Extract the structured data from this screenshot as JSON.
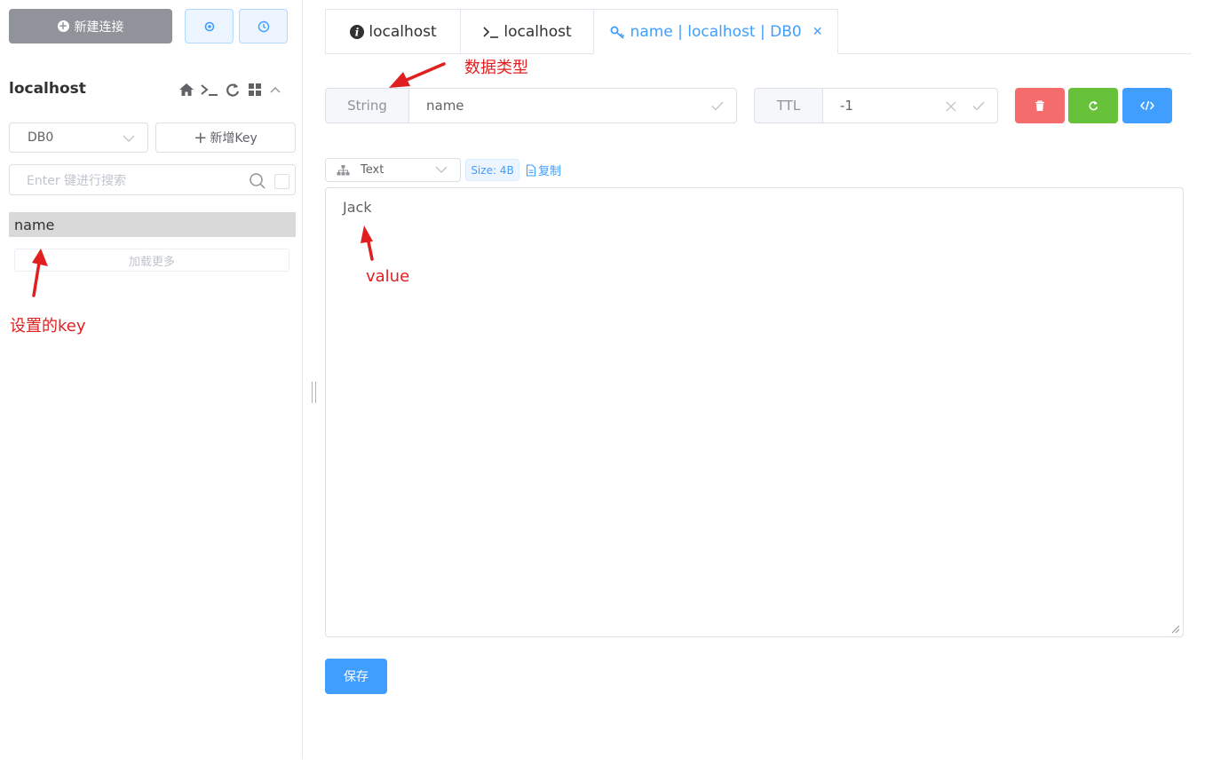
{
  "sidebar": {
    "new_connection_label": "新建连接",
    "connection_name": "localhost",
    "db_select_value": "DB0",
    "add_key_label": "新增Key",
    "search_placeholder": "Enter 键进行搜索",
    "keys": [
      "name"
    ],
    "load_more_label": "加载更多"
  },
  "tabs": [
    {
      "label": "localhost",
      "icon": "info-icon"
    },
    {
      "label": "localhost",
      "icon": "terminal-icon"
    },
    {
      "label": "name | localhost | DB0",
      "icon": "key-icon"
    }
  ],
  "key_detail": {
    "type_label": "String",
    "key_name": "name",
    "ttl_label": "TTL",
    "ttl_value": "-1",
    "format_value": "Text",
    "size_label": "Size: 4B",
    "copy_label": "复制",
    "value_text": "Jack",
    "save_label": "保存"
  },
  "annotations": {
    "data_type": "数据类型",
    "value": "value",
    "key": "设置的key"
  },
  "colors": {
    "primary": "#409eff",
    "danger": "#f56c6c",
    "success": "#67c23a",
    "info": "#909399",
    "annotation_red": "#e02020"
  }
}
